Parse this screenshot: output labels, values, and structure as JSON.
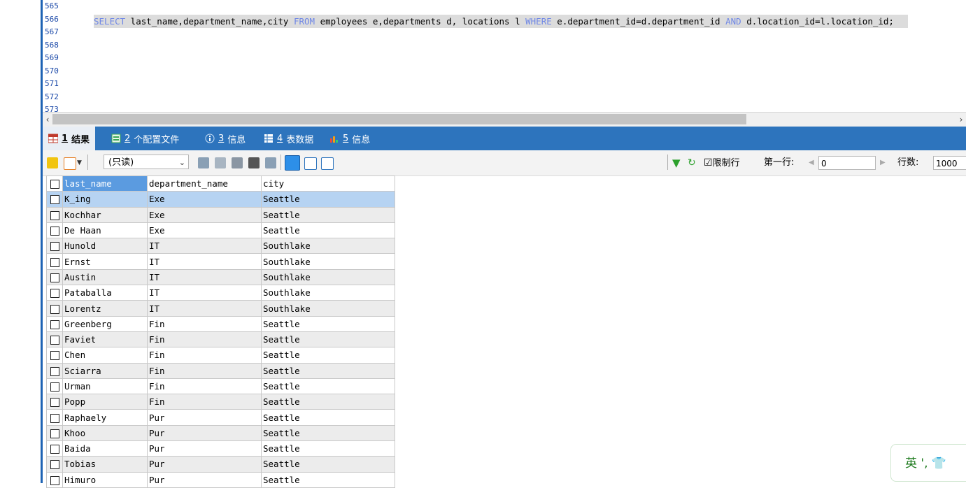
{
  "editor": {
    "line_numbers": [
      "565",
      "566",
      "567",
      "568",
      "569",
      "570",
      "571",
      "572",
      "573"
    ],
    "sql_tokens": [
      {
        "t": "SELECT",
        "kw": true
      },
      {
        "t": " last_name,department_name,city ",
        "kw": false
      },
      {
        "t": "FROM",
        "kw": true
      },
      {
        "t": " employees e,departments d, locations l ",
        "kw": false
      },
      {
        "t": "WHERE",
        "kw": true
      },
      {
        "t": " e.department_id=d.department_id ",
        "kw": false
      },
      {
        "t": "AND",
        "kw": true
      },
      {
        "t": " d.location_id=l.location_id;",
        "kw": false
      }
    ],
    "scroll_left_icon": "‹",
    "scroll_right_icon": "›"
  },
  "tabs": [
    {
      "num": "1",
      "label": "结果",
      "icon": "grid-icon",
      "active": true
    },
    {
      "num": "2",
      "label": "个配置文件",
      "icon": "profile-icon",
      "active": false
    },
    {
      "num": "3",
      "label": "信息",
      "icon": "info-icon",
      "active": false
    },
    {
      "num": "4",
      "label": "表数据",
      "icon": "table-icon",
      "active": false
    },
    {
      "num": "5",
      "label": "信息",
      "icon": "chart-icon",
      "active": false
    }
  ],
  "toolbar": {
    "readonly_label": "(只读)",
    "limit_label": "限制行",
    "first_row_label": "第一行:",
    "first_row_value": "0",
    "rows_label": "行数:",
    "rows_value": "1000"
  },
  "grid": {
    "columns": [
      "last_name",
      "department_name",
      "city"
    ],
    "rows": [
      [
        "K_ing",
        "Exe",
        "Seattle"
      ],
      [
        "Kochhar",
        "Exe",
        "Seattle"
      ],
      [
        "De Haan",
        "Exe",
        "Seattle"
      ],
      [
        "Hunold",
        "IT",
        "Southlake"
      ],
      [
        "Ernst",
        "IT",
        "Southlake"
      ],
      [
        "Austin",
        "IT",
        "Southlake"
      ],
      [
        "Pataballa",
        "IT",
        "Southlake"
      ],
      [
        "Lorentz",
        "IT",
        "Southlake"
      ],
      [
        "Greenberg",
        "Fin",
        "Seattle"
      ],
      [
        "Faviet",
        "Fin",
        "Seattle"
      ],
      [
        "Chen",
        "Fin",
        "Seattle"
      ],
      [
        "Sciarra",
        "Fin",
        "Seattle"
      ],
      [
        "Urman",
        "Fin",
        "Seattle"
      ],
      [
        "Popp",
        "Fin",
        "Seattle"
      ],
      [
        "Raphaely",
        "Pur",
        "Seattle"
      ],
      [
        "Khoo",
        "Pur",
        "Seattle"
      ],
      [
        "Baida",
        "Pur",
        "Seattle"
      ],
      [
        "Tobias",
        "Pur",
        "Seattle"
      ],
      [
        "Himuro",
        "Pur",
        "Seattle"
      ]
    ]
  },
  "ime": {
    "label": "英 ', 👕"
  },
  "colors": {
    "accent": "#2d74bd",
    "selected_row": "#b6d3f2",
    "selected_header": "#5b9be0"
  }
}
